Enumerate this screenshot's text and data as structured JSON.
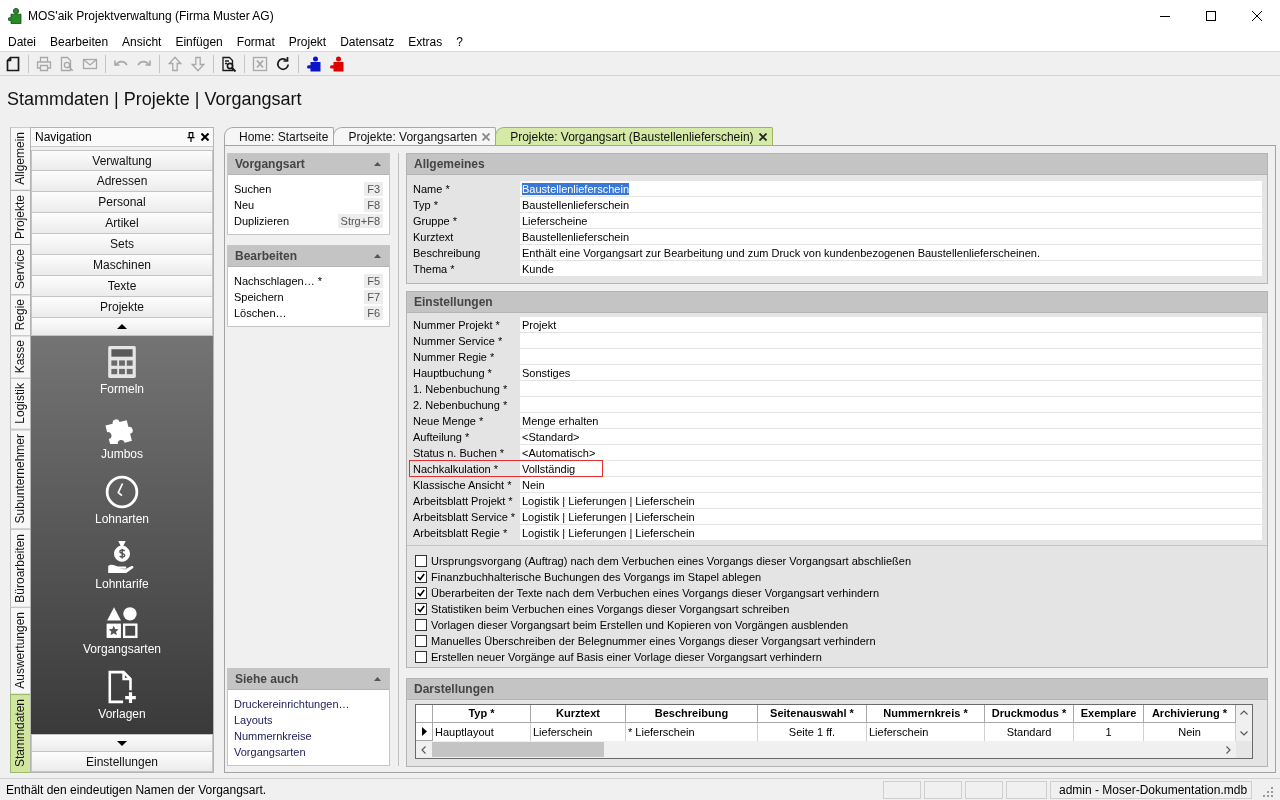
{
  "window": {
    "title": "MOS'aik Projektverwaltung (Firma Muster AG)"
  },
  "menu": [
    "Datei",
    "Bearbeiten",
    "Ansicht",
    "Einfügen",
    "Format",
    "Projekt",
    "Datensatz",
    "Extras",
    "?"
  ],
  "toolbar": [
    [
      {
        "kind": "new",
        "disabled": false
      }
    ],
    [
      {
        "kind": "print",
        "disabled": true
      },
      {
        "kind": "preview",
        "disabled": true
      },
      {
        "kind": "mail",
        "disabled": true
      }
    ],
    [
      {
        "kind": "undo",
        "disabled": true
      },
      {
        "kind": "redo",
        "disabled": true
      }
    ],
    [
      {
        "kind": "up",
        "disabled": true
      },
      {
        "kind": "down",
        "disabled": true
      }
    ],
    [
      {
        "kind": "find",
        "disabled": false
      }
    ],
    [
      {
        "kind": "excel",
        "disabled": true
      },
      {
        "kind": "refresh",
        "disabled": false
      }
    ],
    [
      {
        "kind": "puzzle",
        "disabled": false,
        "color": "#0a14c8"
      },
      {
        "kind": "puzzle",
        "disabled": false,
        "color": "#e00000"
      }
    ]
  ],
  "breadcrumb": "Stammdaten | Projekte | Vorgangsart",
  "side_tabs": [
    {
      "label": "Allgemein",
      "selected": false
    },
    {
      "label": "Projekte",
      "selected": false
    },
    {
      "label": "Service",
      "selected": false
    },
    {
      "label": "Regie",
      "selected": false
    },
    {
      "label": "Kasse",
      "selected": false
    },
    {
      "label": "Logistik",
      "selected": false
    },
    {
      "label": "Subunternehmer",
      "selected": false
    },
    {
      "label": "Büroarbeiten",
      "selected": false
    },
    {
      "label": "Auswertungen",
      "selected": false
    },
    {
      "label": "Stammdaten",
      "selected": true
    }
  ],
  "navigation": {
    "title": "Navigation",
    "items": [
      "Verwaltung",
      "Adressen",
      "Personal",
      "Artikel",
      "Sets",
      "Maschinen",
      "Texte",
      "Projekte"
    ],
    "modules": [
      {
        "kind": "calculator",
        "label": "Formeln"
      },
      {
        "kind": "puzzle",
        "label": "Jumbos"
      },
      {
        "kind": "clock",
        "label": "Lohnarten"
      },
      {
        "kind": "money",
        "label": "Lohntarife"
      },
      {
        "kind": "shapes",
        "label": "Vorgangsarten"
      },
      {
        "kind": "document",
        "label": "Vorlagen"
      }
    ],
    "footer": "Einstellungen"
  },
  "doc_tabs": [
    {
      "label": "Home: Startseite",
      "closable": false,
      "selected": false
    },
    {
      "label": "Projekte: Vorgangsarten",
      "closable": true,
      "selected": false
    },
    {
      "label": "Projekte: Vorgangsart (Baustellenlieferschein)",
      "closable": true,
      "selected": true
    }
  ],
  "task_panels": [
    {
      "title": "Vorgangsart",
      "kind": "commands",
      "items": [
        {
          "label": "Suchen",
          "shortcut": "F3"
        },
        {
          "label": "Neu",
          "shortcut": "F8"
        },
        {
          "label": "Duplizieren",
          "shortcut": "Strg+F8"
        }
      ]
    },
    {
      "title": "Bearbeiten",
      "kind": "commands",
      "items": [
        {
          "label": "Nachschlagen… *",
          "shortcut": "F5"
        },
        {
          "label": "Speichern",
          "shortcut": "F7"
        },
        {
          "label": "Löschen…",
          "shortcut": "F6"
        }
      ]
    },
    {
      "title": "Siehe auch",
      "kind": "links",
      "items": [
        {
          "label": "Druckereinrichtungen…"
        },
        {
          "label": "Layouts"
        },
        {
          "label": "Nummernkreise"
        },
        {
          "label": "Vorgangsarten"
        }
      ]
    }
  ],
  "general": {
    "title": "Allgemeines",
    "fields": [
      {
        "label": "Name *",
        "value": "Baustellenlieferschein",
        "selected": true
      },
      {
        "label": "Typ *",
        "value": "Baustellenlieferschein",
        "selected": false
      },
      {
        "label": "Gruppe *",
        "value": "Lieferscheine",
        "selected": false
      },
      {
        "label": "Kurztext",
        "value": "Baustellenlieferschein",
        "selected": false
      },
      {
        "label": "Beschreibung",
        "value": "Enthält eine Vorgangsart zur Bearbeitung und zum Druck von kundenbezogenen Baustellenlieferscheinen.",
        "selected": false
      },
      {
        "label": "Thema *",
        "value": "Kunde",
        "selected": false
      }
    ]
  },
  "settings": {
    "title": "Einstellungen",
    "fields": [
      {
        "label": "Nummer Projekt *",
        "value": "Projekt",
        "outlined": false
      },
      {
        "label": "Nummer Service *",
        "outlined": false
      },
      {
        "label": "Nummer Regie *",
        "outlined": false
      },
      {
        "label": "Hauptbuchung *",
        "value": "Sonstiges",
        "outlined": false
      },
      {
        "label": "1. Nebenbuchung *",
        "outlined": false
      },
      {
        "label": "2. Nebenbuchung *",
        "outlined": false
      },
      {
        "label": "Neue Menge *",
        "value": "Menge erhalten",
        "outlined": false
      },
      {
        "label": "Aufteilung *",
        "value": "<Standard>",
        "outlined": false
      },
      {
        "label": "Status n. Buchen *",
        "value": "<Automatisch>",
        "outlined": false
      },
      {
        "label": "Nachkalkulation *",
        "value": "Vollständig",
        "outlined": true
      },
      {
        "label": "Klassische Ansicht *",
        "value": "Nein",
        "outlined": false
      },
      {
        "label": "Arbeitsblatt Projekt *",
        "value": "Logistik | Lieferungen | Lieferschein",
        "outlined": false
      },
      {
        "label": "Arbeitsblatt Service *",
        "value": "Logistik | Lieferungen | Lieferschein",
        "outlined": false
      },
      {
        "label": "Arbeitsblatt Regie *",
        "value": "Logistik | Lieferungen | Lieferschein",
        "outlined": false
      }
    ],
    "options": [
      {
        "label": "Ursprungsvorgang (Auftrag) nach dem Verbuchen eines Vorgangs dieser Vorgangsart abschließen",
        "checked": false
      },
      {
        "label": "Finanzbuchhalterische Buchungen des Vorgangs im Stapel ablegen",
        "checked": true
      },
      {
        "label": "Überarbeiten der Texte nach dem Verbuchen eines Vorgangs dieser Vorgangsart verhindern",
        "checked": true
      },
      {
        "label": "Statistiken beim Verbuchen eines Vorgangs dieser Vorgangsart schreiben",
        "checked": true
      },
      {
        "label": "Vorlagen dieser Vorgangsart beim Erstellen und Kopieren von Vorgängen ausblenden",
        "checked": false
      },
      {
        "label": "Manuelles Überschreiben der Belegnummer eines Vorgangs dieser Vorgangsart verhindern",
        "checked": false
      },
      {
        "label": "Erstellen neuer Vorgänge auf Basis einer Vorlage dieser Vorgangsart verhindern",
        "checked": false
      }
    ]
  },
  "layouts": {
    "title": "Darstellungen",
    "table": {
      "columns": [
        "Typ *",
        "Kurztext",
        "Beschreibung",
        "Seitenauswahl *",
        "Nummernkreis *",
        "Druckmodus *",
        "Exemplare",
        "Archivierung *"
      ],
      "rows": [
        {
          "selected": true,
          "cells": [
            "Hauptlayout",
            "Lieferschein",
            "* Lieferschein",
            "Seite 1 ff.",
            "Lieferschein",
            "Standard",
            "1",
            "Nein"
          ]
        }
      ]
    }
  },
  "status_bar": {
    "message": "Enthält den eindeutigen Namen der Vorgangsart.",
    "panels": [
      "admin - Moser-Dokumentation.mdb"
    ]
  }
}
